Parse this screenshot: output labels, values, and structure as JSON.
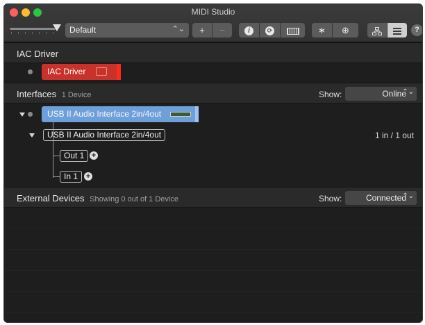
{
  "window": {
    "title": "MIDI Studio"
  },
  "toolbar": {
    "configuration": "Default",
    "add_label": "+",
    "remove_label": "−",
    "info_glyph": "i",
    "rescan_glyph": "⟳",
    "bluetooth_glyph": "∗",
    "network_glyph": "⊕",
    "help_label": "?"
  },
  "iac": {
    "section_title": "IAC Driver",
    "device_label": "IAC Driver"
  },
  "interfaces": {
    "section_title": "Interfaces",
    "count_label": "1 Device",
    "show_label": "Show:",
    "show_value": "Online",
    "device_label": "USB II Audio Interface 2in/4out",
    "entity_label": "USB II Audio Interface 2in/4out",
    "ports_summary": "1 in / 1 out",
    "ports": [
      {
        "label": "Out 1"
      },
      {
        "label": "In 1"
      }
    ]
  },
  "external": {
    "section_title": "External Devices",
    "count_label": "Showing 0 out of 1 Device",
    "show_label": "Show:",
    "show_value": "Connected"
  },
  "colors": {
    "iac_chip": "#c8322b",
    "usb_chip": "#6f9fd8",
    "background": "#1e1e1e"
  }
}
